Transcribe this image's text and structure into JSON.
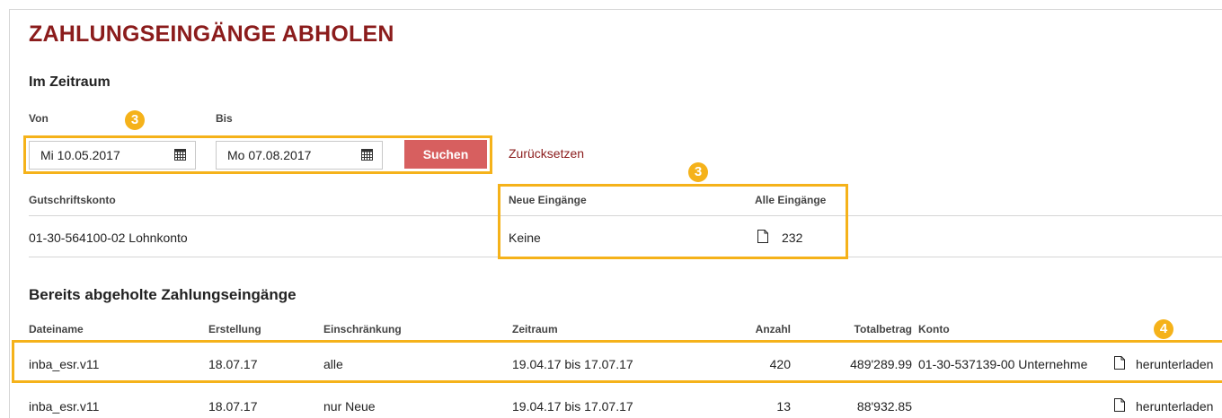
{
  "page": {
    "title": "ZAHLUNGSEINGÄNGE ABHOLEN",
    "section_title": "Im Zeitraum"
  },
  "filter": {
    "from_label": "Von",
    "to_label": "Bis",
    "from_value": "Mi  10.05.2017",
    "to_value": "Mo  07.08.2017",
    "search_label": "Suchen",
    "reset_label": "Zurücksetzen"
  },
  "annotations": {
    "badge_filter": "3",
    "badge_counts": "3",
    "badge_download": "4",
    "highlight_color": "#f5b21a"
  },
  "account_table": {
    "headers": {
      "account": "Gutschriftskonto",
      "new": "Neue Eingänge",
      "all": "Alle Eingänge"
    },
    "row": {
      "account": "01-30-564100-02 Lohnkonto",
      "new": "Keine",
      "all": "232",
      "all_icon": "document-icon"
    }
  },
  "fetched": {
    "title": "Bereits abgeholte Zahlungseingänge",
    "headers": {
      "filename": "Dateiname",
      "created": "Erstellung",
      "restriction": "Einschränkung",
      "period": "Zeitraum",
      "count": "Anzahl",
      "total": "Totalbetrag",
      "account": "Konto"
    },
    "rows": [
      {
        "filename": "inba_esr.v11",
        "created": "18.07.17",
        "restriction": "alle",
        "period": "19.04.17 bis 17.07.17",
        "count": "420",
        "total": "489'289.99",
        "account": "01-30-537139-00 Unternehme",
        "download": "herunterladen"
      },
      {
        "filename": "inba_esr.v11",
        "created": "18.07.17",
        "restriction": "nur Neue",
        "period": "19.04.17 bis 17.07.17",
        "count": "13",
        "total": "88'932.85",
        "account": "",
        "download": "herunterladen"
      }
    ]
  },
  "colors": {
    "title": "#8b1c1c",
    "button": "#d75f5f",
    "link": "#8b1c1c",
    "badge": "#f5b21a"
  }
}
